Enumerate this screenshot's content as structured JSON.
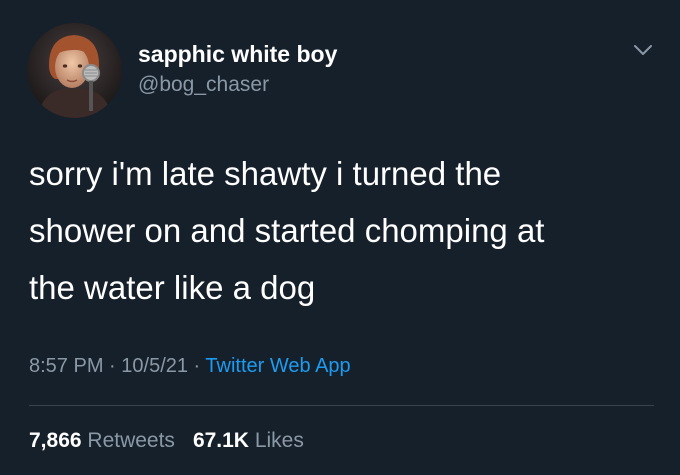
{
  "user": {
    "display_name": "sapphic white boy",
    "handle": "@bog_chaser",
    "avatar_icon": "profile-photo"
  },
  "tweet": {
    "text": "sorry i'm late shawty i turned the shower on and started chomping at the water like a dog",
    "lines": [
      "sorry i'm late shawty i turned the",
      "shower on and started chomping at",
      "the water like a dog"
    ],
    "time": "8:57 PM",
    "separator": " · ",
    "date": "10/5/21",
    "source": "Twitter Web App"
  },
  "stats": {
    "retweets_count": "7,866",
    "retweets_label": " Retweets",
    "likes_count": "67.1K",
    "likes_label": " Likes"
  },
  "colors": {
    "background": "#15202b",
    "text_primary": "#ffffff",
    "text_secondary": "#8b98a5",
    "link": "#1d9bf0",
    "divider": "#38444d"
  },
  "icons": {
    "menu": "chevron-down-icon"
  }
}
